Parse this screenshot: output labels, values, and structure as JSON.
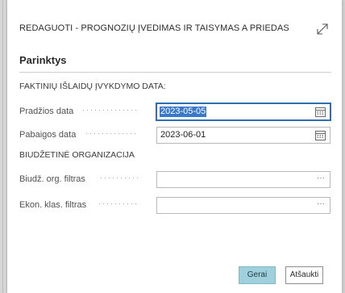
{
  "dialog": {
    "title": "REDAGUOTI - PROGNOZIŲ ĮVEDIMAS IR TAISYMAS A PRIEDAS",
    "expand_icon": "expand-diagonal-arrow-icon"
  },
  "options": {
    "section_title": "Parinktys",
    "group_actual": {
      "label": "FAKTINIŲ IŠLAIDŲ ĮVYKDYMO DATA:",
      "start_date": {
        "label": "Pradžios data",
        "value": "2023-05-05",
        "icon": "calendar-icon"
      },
      "end_date": {
        "label": "Pabaigos data",
        "value": "2023-06-01",
        "icon": "calendar-icon"
      }
    },
    "group_org": {
      "label": "BIUDŽETINĖ ORGANIZACIJA",
      "org_filter": {
        "label": "Biudž. org. filtras",
        "value": "",
        "action": "···"
      },
      "econ_filter": {
        "label": "Ekon. klas. filtras",
        "value": "",
        "action": "···"
      }
    }
  },
  "buttons": {
    "ok": "Gerai",
    "cancel": "Atšaukti"
  },
  "colors": {
    "accent_button": "#9fd0dc",
    "focus_border": "#2f6fb1",
    "selection": "#3a78c9"
  }
}
